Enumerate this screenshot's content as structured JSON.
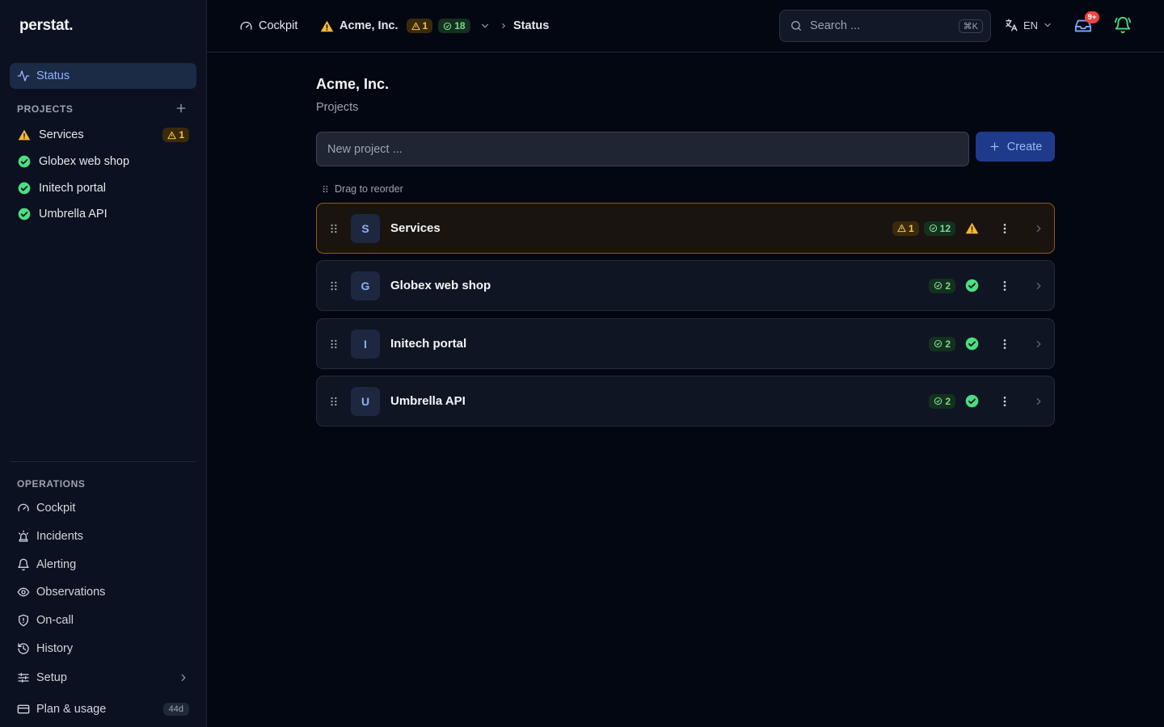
{
  "app": {
    "logo": "perstat."
  },
  "colors": {
    "accent": "#8fb4ff",
    "warning": "#f4c24d",
    "ok": "#4ade80",
    "danger": "#ef4444"
  },
  "sidebar": {
    "status_label": "Status",
    "projects_heading": "PROJECTS",
    "projects": [
      {
        "name": "Services",
        "status": "warning",
        "warn_count": "1"
      },
      {
        "name": "Globex web shop",
        "status": "ok"
      },
      {
        "name": "Initech portal",
        "status": "ok"
      },
      {
        "name": "Umbrella API",
        "status": "ok"
      }
    ],
    "operations_heading": "OPERATIONS",
    "operations": [
      {
        "label": "Cockpit",
        "icon": "gauge-icon"
      },
      {
        "label": "Incidents",
        "icon": "siren-icon"
      },
      {
        "label": "Alerting",
        "icon": "bell-icon"
      },
      {
        "label": "Observations",
        "icon": "eye-icon"
      },
      {
        "label": "On-call",
        "icon": "shield-icon"
      },
      {
        "label": "History",
        "icon": "history-icon"
      },
      {
        "label": "Setup",
        "icon": "sliders-icon"
      },
      {
        "label": "Plan & usage",
        "icon": "card-icon",
        "badge": "44d"
      }
    ]
  },
  "topbar": {
    "cockpit": "Cockpit",
    "org": "Acme, Inc.",
    "org_warn": "1",
    "org_ok": "18",
    "current": "Status",
    "search_placeholder": "Search ...",
    "search_shortcut": "⌘K",
    "lang": "EN",
    "inbox_badge": "9+"
  },
  "main": {
    "title": "Acme, Inc.",
    "subtitle": "Projects",
    "new_project_placeholder": "New project ...",
    "create_label": "Create",
    "drag_hint": "Drag to reorder",
    "rows": [
      {
        "initial": "S",
        "name": "Services",
        "warn": "1",
        "ok": "12",
        "status": "warning"
      },
      {
        "initial": "G",
        "name": "Globex web shop",
        "ok": "2",
        "status": "ok"
      },
      {
        "initial": "I",
        "name": "Initech portal",
        "ok": "2",
        "status": "ok"
      },
      {
        "initial": "U",
        "name": "Umbrella API",
        "ok": "2",
        "status": "ok"
      }
    ]
  }
}
